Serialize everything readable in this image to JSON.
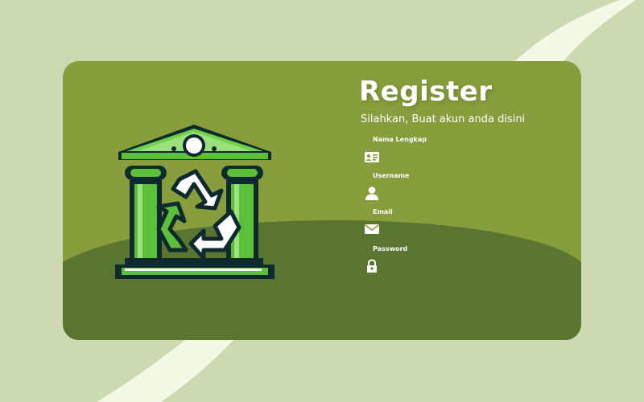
{
  "register": {
    "title": "Register",
    "subtitle": "Silahkan, Buat akun anda disini",
    "fields": [
      {
        "label": "Nama Lengkap",
        "icon": "id-card-icon",
        "value": ""
      },
      {
        "label": "Username",
        "icon": "user-icon",
        "value": ""
      },
      {
        "label": "Email",
        "icon": "envelope-icon",
        "value": ""
      },
      {
        "label": "Password",
        "icon": "lock-icon",
        "value": ""
      }
    ]
  },
  "logo": {
    "icon": "bank-recycle-logo"
  },
  "colors": {
    "page_background": "#cdd9b0",
    "swoosh": "#f3f9e4",
    "card": "#889e3c",
    "hill": "#5a7530",
    "logo_green": "#5cbf3a",
    "logo_outline": "#0f2a2e"
  }
}
